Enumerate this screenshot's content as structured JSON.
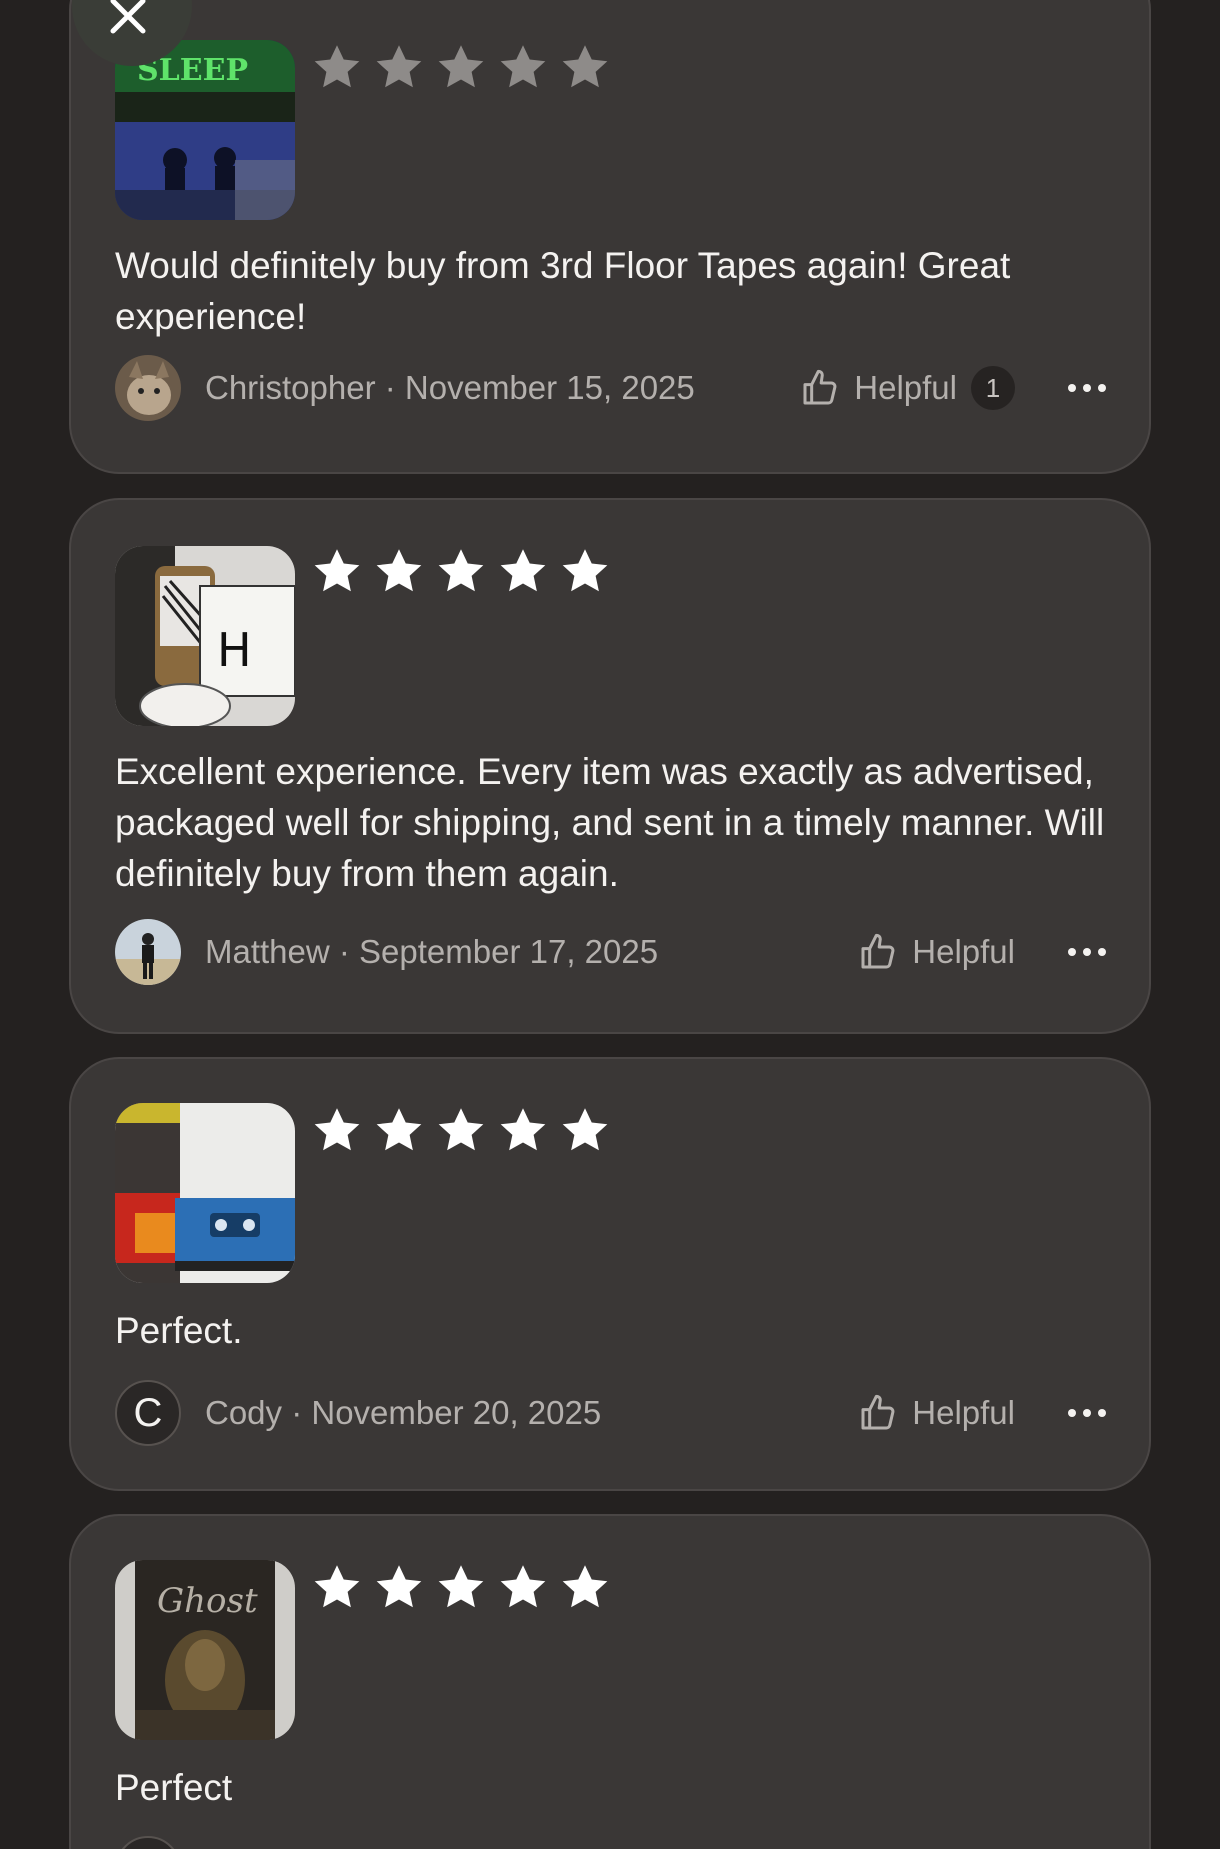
{
  "close_button": {
    "icon": "close-icon"
  },
  "reviews": [
    {
      "rating": 5,
      "star_color": "#8e8b89",
      "text": "Would definitely buy from 3rd Floor Tapes again! Great experience!",
      "reviewer": "Christopher · November 15, 2025",
      "helpful_label": "Helpful",
      "helpful_count": "1",
      "thumb_text": "SLEEP",
      "avatar": "cat-photo"
    },
    {
      "rating": 5,
      "star_color": "#ffffff",
      "text": "Excellent experience. Every item was exactly as advertised, packaged well for shipping, and sent in a timely manner. Will definitely buy from them again.",
      "reviewer": "Matthew · September 17, 2025",
      "helpful_label": "Helpful",
      "avatar": "person-photo"
    },
    {
      "rating": 5,
      "star_color": "#ffffff",
      "text": "Perfect.",
      "reviewer": "Cody · November 20, 2025",
      "helpful_label": "Helpful",
      "avatar_letter": "C"
    },
    {
      "rating": 5,
      "star_color": "#ffffff",
      "text": "Perfect",
      "thumb_text": "Ghost"
    }
  ]
}
